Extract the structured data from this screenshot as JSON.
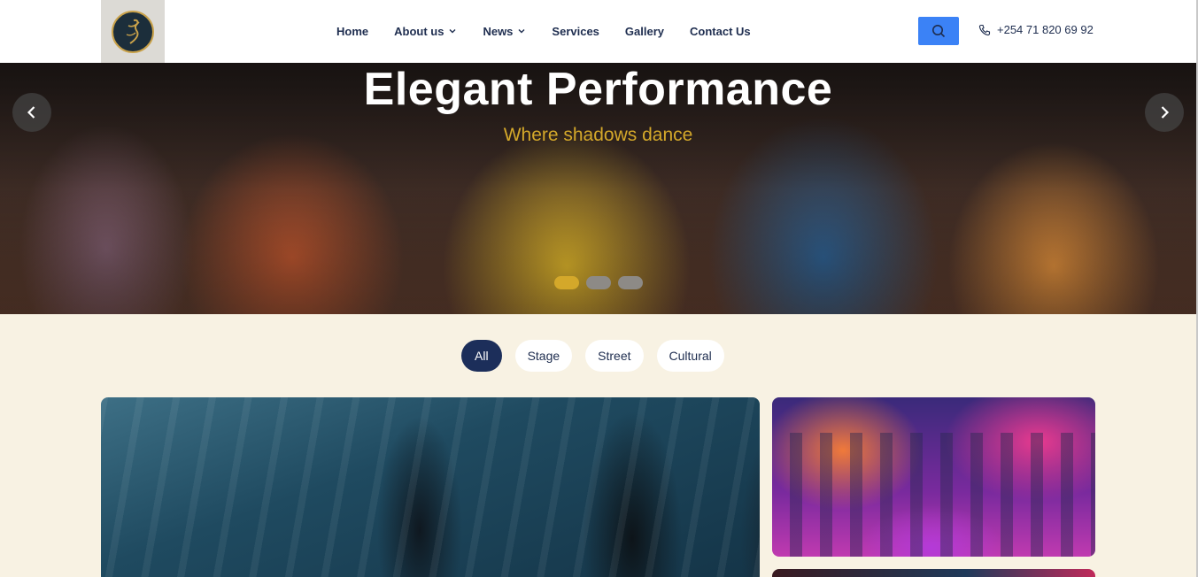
{
  "header": {
    "logo_alt": "dance logo",
    "nav": [
      {
        "label": "Home",
        "dropdown": false
      },
      {
        "label": "About us",
        "dropdown": true
      },
      {
        "label": "News",
        "dropdown": true
      },
      {
        "label": "Services",
        "dropdown": false
      },
      {
        "label": "Gallery",
        "dropdown": false
      },
      {
        "label": "Contact Us",
        "dropdown": false
      }
    ],
    "search_icon": "search-icon",
    "phone": "+254 71 820 69 92",
    "accent_color": "#3b82f6"
  },
  "hero": {
    "title": "Elegant Performance",
    "subtitle": "Where shadows dance",
    "subtitle_color": "#d4a82a",
    "slides_total": 3,
    "active_slide": 1
  },
  "filters": {
    "items": [
      "All",
      "Stage",
      "Street",
      "Cultural"
    ],
    "active": "All",
    "active_color": "#1c2e5a"
  }
}
